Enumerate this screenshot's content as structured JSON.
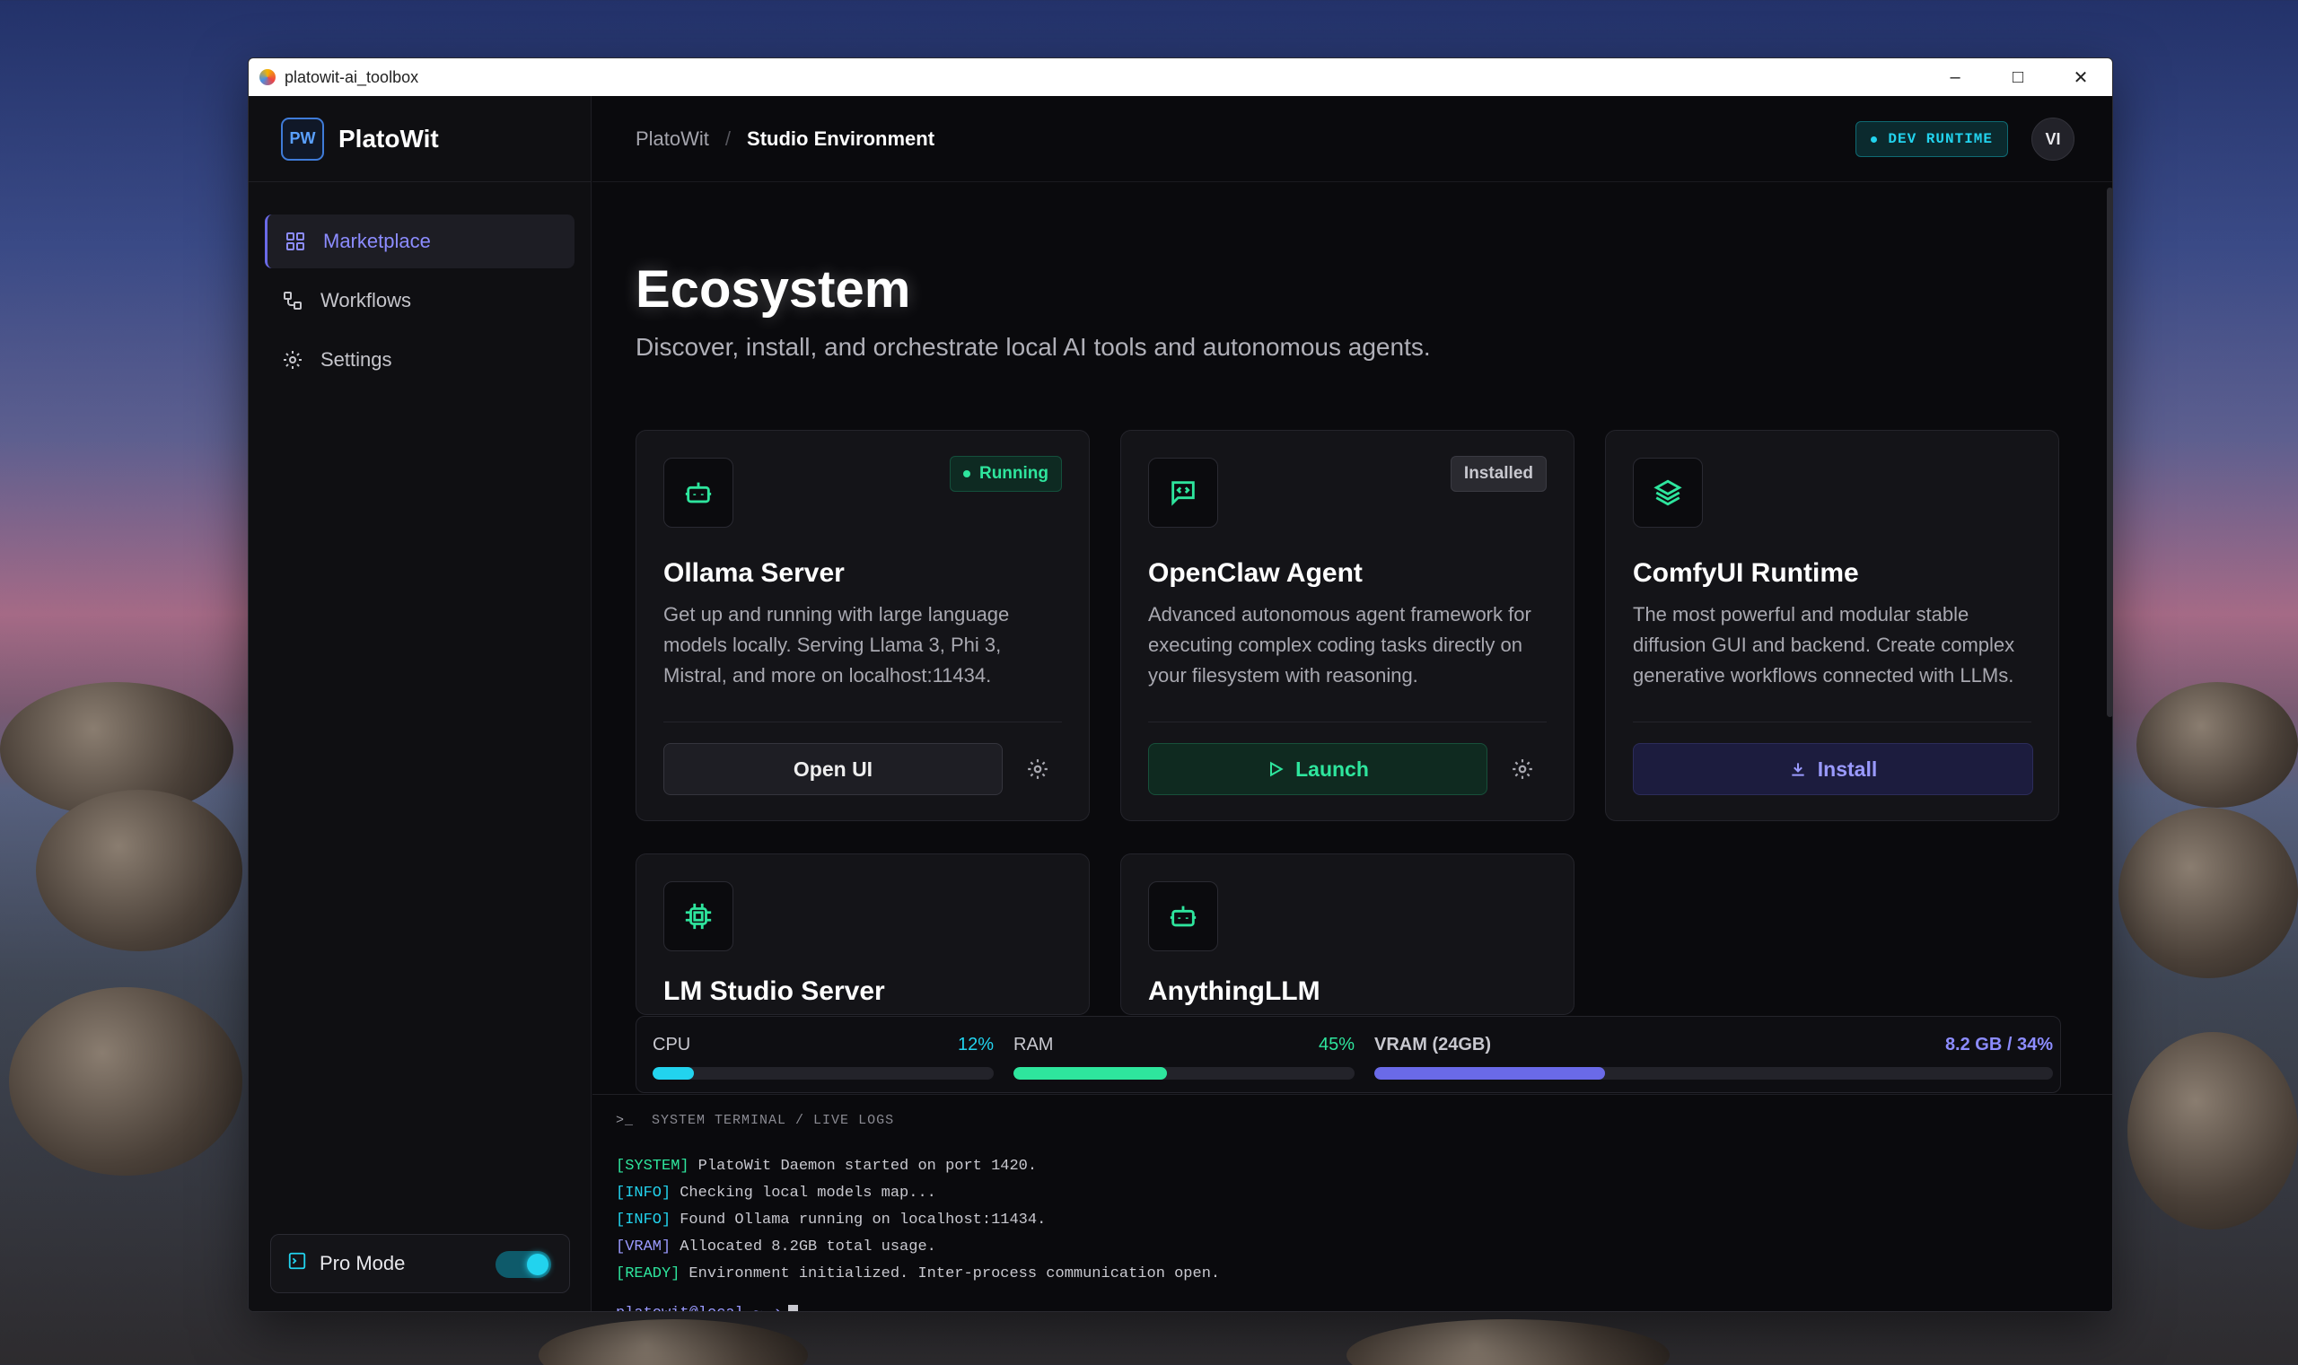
{
  "window": {
    "title": "platowit-ai_toolbox"
  },
  "sidebar": {
    "logo_text": "PW",
    "brand": "PlatoWit",
    "items": [
      {
        "label": "Marketplace",
        "icon": "grid-icon",
        "active": true
      },
      {
        "label": "Workflows",
        "icon": "workflow-icon",
        "active": false
      },
      {
        "label": "Settings",
        "icon": "gear-icon",
        "active": false
      }
    ],
    "pro_mode": {
      "label": "Pro Mode",
      "enabled": true
    }
  },
  "header": {
    "breadcrumb_root": "PlatoWit",
    "breadcrumb_sep": "/",
    "breadcrumb_current": "Studio Environment",
    "runtime_badge": "DEV RUNTIME",
    "avatar_initials": "VI"
  },
  "page": {
    "title": "Ecosystem",
    "subtitle": "Discover, install, and orchestrate local AI tools and autonomous agents."
  },
  "cards": [
    {
      "title": "Ollama Server",
      "icon": "bot-icon",
      "status": "Running",
      "desc": "Get up and running with large language models locally. Serving Llama 3, Phi 3, Mistral, and more on localhost:11434.",
      "action": "Open UI"
    },
    {
      "title": "OpenClaw Agent",
      "icon": "code-message-icon",
      "status": "Installed",
      "desc": "Advanced autonomous agent framework for executing complex coding tasks directly on your filesystem with reasoning.",
      "action": "Launch"
    },
    {
      "title": "ComfyUI Runtime",
      "icon": "layers-icon",
      "status": "",
      "desc": "The most powerful and modular stable diffusion GUI and backend. Create complex generative workflows connected with LLMs.",
      "action": "Install"
    },
    {
      "title": "LM Studio Server",
      "icon": "chip-icon"
    },
    {
      "title": "AnythingLLM",
      "icon": "bot-icon"
    }
  ],
  "metrics": {
    "cpu": {
      "label": "CPU",
      "value": "12%",
      "fraction": 0.12,
      "color": "#22d3ee"
    },
    "ram": {
      "label": "RAM",
      "value": "45%",
      "fraction": 0.45,
      "color": "#2ee59d"
    },
    "vram": {
      "label": "VRAM (24GB)",
      "value": "8.2 GB / 34%",
      "fraction": 0.34,
      "color": "#6a6ae8"
    }
  },
  "terminal": {
    "header": "SYSTEM TERMINAL / LIVE LOGS",
    "prompt_symbol": ">_",
    "lines": [
      {
        "tag": "[SYSTEM]",
        "text": "PlatoWit Daemon started on port 1420.",
        "color": "#2ee59d"
      },
      {
        "tag": "[INFO]",
        "text": "Checking local models map...",
        "color": "#22d3ee"
      },
      {
        "tag": "[INFO]",
        "text": "Found Ollama running on localhost:11434.",
        "color": "#22d3ee"
      },
      {
        "tag": "[VRAM]",
        "text": "Allocated 8.2GB total usage.",
        "color": "#9a9aff"
      },
      {
        "tag": "[READY]",
        "text": "Environment initialized. Inter-process communication open.",
        "color": "#2ee59d"
      }
    ],
    "prompt": "platowit@local ~ ➔"
  }
}
